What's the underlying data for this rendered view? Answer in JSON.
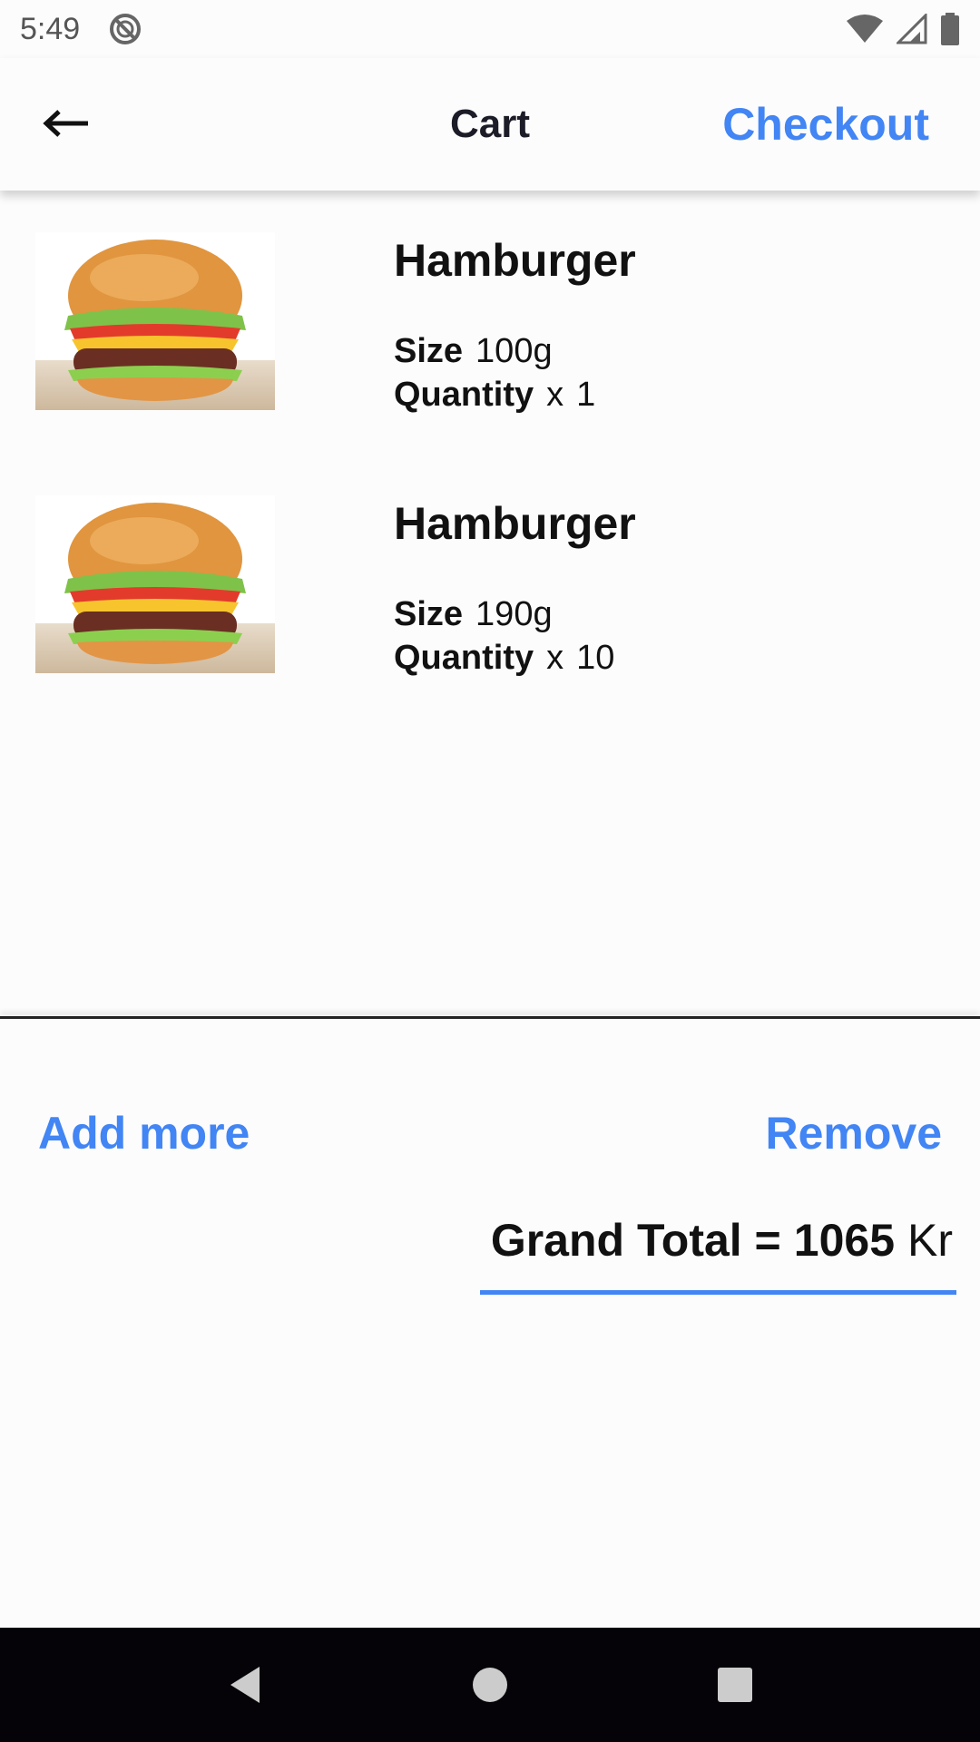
{
  "status_bar": {
    "time": "5:49",
    "icons": [
      "do-not-disturb-icon",
      "wifi-icon",
      "signal-icon",
      "battery-icon"
    ]
  },
  "app_bar": {
    "title": "Cart",
    "back_icon": "arrow-left-icon",
    "checkout_label": "Checkout"
  },
  "cart": {
    "size_label": "Size",
    "quantity_label": "Quantity",
    "quantity_prefix": "x",
    "items": [
      {
        "name": "Hamburger",
        "size": "100g",
        "quantity": "1",
        "image": "hamburger-image"
      },
      {
        "name": "Hamburger",
        "size": "190g",
        "quantity": "10",
        "image": "hamburger-image"
      }
    ]
  },
  "actions": {
    "add_more_label": "Add more",
    "remove_label": "Remove"
  },
  "total": {
    "label": "Grand Total =",
    "value": "1065",
    "currency": "Kr"
  },
  "nav": {
    "icons": [
      "back-triangle-icon",
      "home-circle-icon",
      "recents-square-icon"
    ]
  },
  "colors": {
    "accent": "#4285f4",
    "background": "#fcfcfc",
    "nav_bar": "#050307"
  }
}
